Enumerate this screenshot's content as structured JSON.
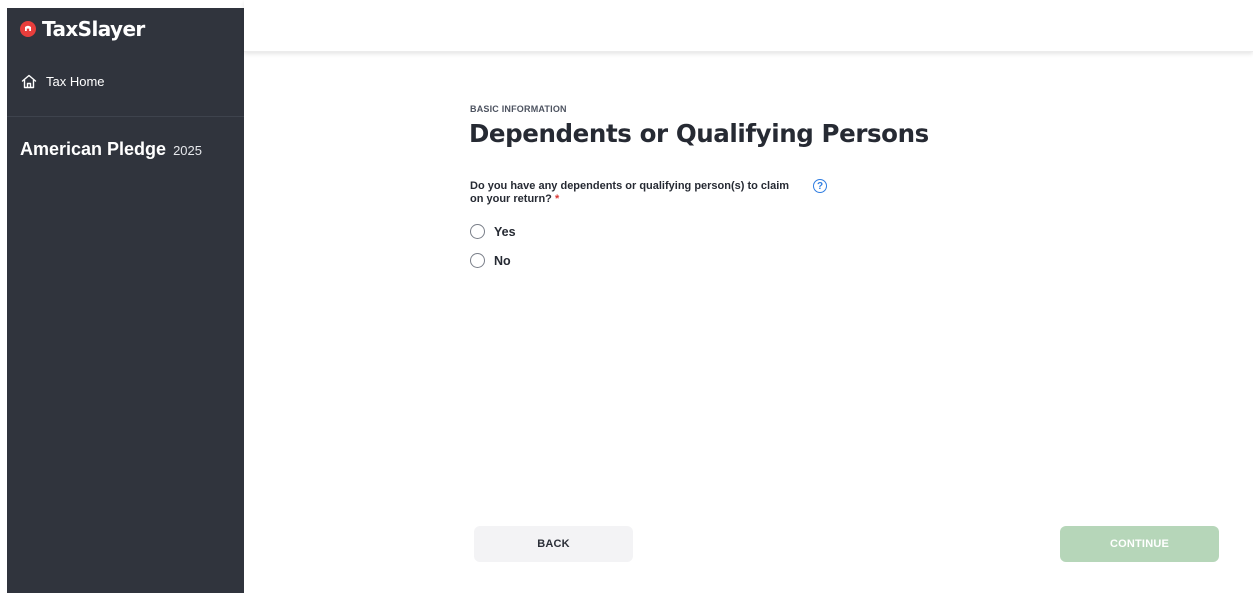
{
  "brand": {
    "name": "TaxSlayer",
    "accent": "#e83e3c"
  },
  "sidebar": {
    "home_label": "Tax Home",
    "return_name": "American Pledge",
    "return_year": "2025",
    "background": "#30343d"
  },
  "main": {
    "section_label": "BASIC INFORMATION",
    "title": "Dependents or Qualifying Persons",
    "question": "Do you have any dependents or qualifying person(s) to claim on your return?",
    "required_marker": "*",
    "help_icon": "question-circle-icon",
    "options": [
      {
        "label": "Yes",
        "selected": false
      },
      {
        "label": "No",
        "selected": false
      }
    ]
  },
  "footer": {
    "back_label": "BACK",
    "continue_label": "CONTINUE",
    "continue_color": "#b6d6b9"
  }
}
